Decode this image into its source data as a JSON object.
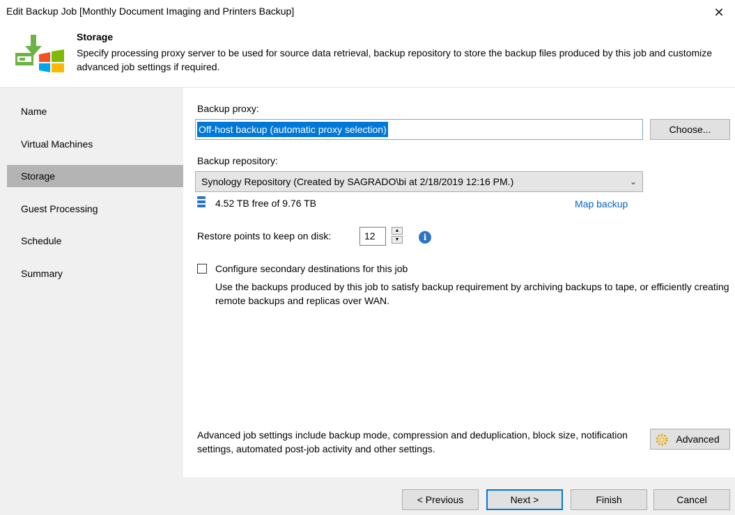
{
  "window": {
    "title": "Edit Backup Job [Monthly Document Imaging and Printers Backup]",
    "close_glyph": "✕"
  },
  "header": {
    "title": "Storage",
    "description": "Specify processing proxy server to be used for source data retrieval, backup repository to store the backup files produced by this job and customize advanced job settings if required.",
    "icon": "backup-to-windows-icon"
  },
  "sidebar": {
    "items": [
      {
        "label": "Name",
        "active": false
      },
      {
        "label": "Virtual Machines",
        "active": false
      },
      {
        "label": "Storage",
        "active": true
      },
      {
        "label": "Guest Processing",
        "active": false
      },
      {
        "label": "Schedule",
        "active": false
      },
      {
        "label": "Summary",
        "active": false
      }
    ]
  },
  "storage": {
    "proxy_label": "Backup proxy:",
    "proxy_value": "Off-host backup (automatic proxy selection)",
    "choose_button": "Choose...",
    "repository_label": "Backup repository:",
    "repository_value": "Synology Repository (Created by SAGRADO\\bi at 2/18/2019 12:16 PM.)",
    "free_space": "4.52 TB free of 9.76 TB",
    "map_backup_link": "Map backup",
    "restore_points_label": "Restore points to keep on disk:",
    "restore_points_value": "12",
    "secondary_label": "Configure secondary destinations for this job",
    "secondary_checked": false,
    "secondary_desc": "Use the backups produced by this job to satisfy backup requirement by archiving backups to tape, or efficiently creating remote backups and replicas over WAN.",
    "advanced_desc": "Advanced job settings include backup mode, compression and deduplication,  block size, notification settings, automated post-job activity and other settings.",
    "advanced_button": "Advanced"
  },
  "footer": {
    "previous": "< Previous",
    "next": "Next >",
    "finish": "Finish",
    "cancel": "Cancel"
  },
  "colors": {
    "sidebar_bg": "#f0f0f0",
    "sidebar_active": "#b4b4b4",
    "selection": "#0078d7",
    "link": "#0066cc",
    "info": "#2c74c6"
  }
}
